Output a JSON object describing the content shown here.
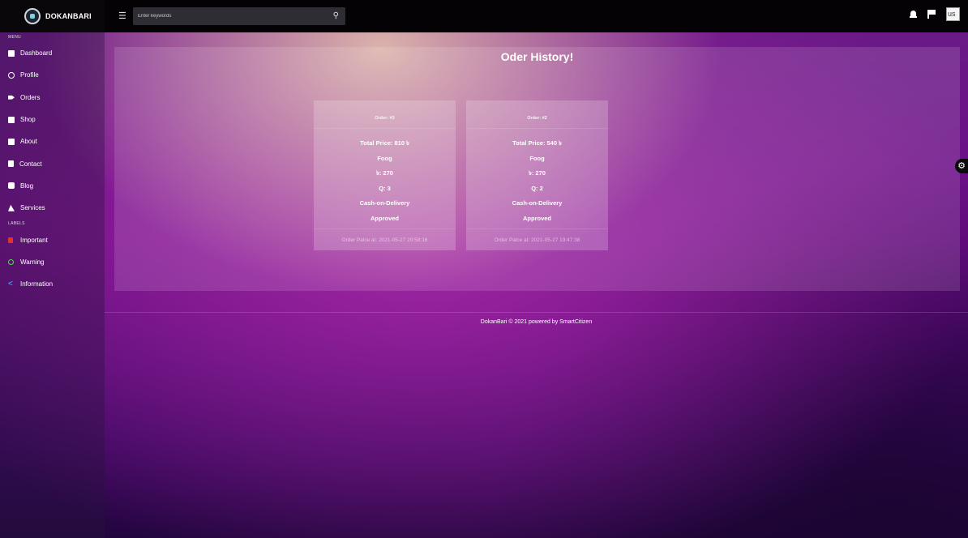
{
  "brand": {
    "name": "DOKANBARI"
  },
  "search": {
    "placeholder": "Enter keywords"
  },
  "header": {
    "avatar_text": "us"
  },
  "sidebar": {
    "menu_heading": "MENU",
    "items": [
      {
        "label": "Dashboard",
        "icon": "dashboard-icon"
      },
      {
        "label": "Profile",
        "icon": "profile-icon"
      },
      {
        "label": "Orders",
        "icon": "tag-icon"
      },
      {
        "label": "Shop",
        "icon": "shop-icon"
      },
      {
        "label": "About",
        "icon": "id-card-icon"
      },
      {
        "label": "Contact",
        "icon": "contact-icon"
      },
      {
        "label": "Blog",
        "icon": "blog-icon"
      },
      {
        "label": "Services",
        "icon": "services-icon"
      }
    ],
    "labels_heading": "LABELS",
    "labels": [
      {
        "label": "Important",
        "color": "#e6332a"
      },
      {
        "label": "Warning",
        "color": "#5bd35b"
      },
      {
        "label": "Information",
        "color": "#4fb8ff"
      }
    ]
  },
  "main": {
    "title": "Oder History!",
    "orders": [
      {
        "order": "Order: #3",
        "total": "Total Price: 810 ৳",
        "product": "Foog",
        "unit_price": "৳: 270",
        "quantity": "Q: 3",
        "payment": "Cash-on-Delivery",
        "status": "Approved",
        "placed": "Order Palce at: 2021-05-27 20:58:16"
      },
      {
        "order": "Order: #2",
        "total": "Total Price: 540 ৳",
        "product": "Foog",
        "unit_price": "৳: 270",
        "quantity": "Q: 2",
        "payment": "Cash-on-Delivery",
        "status": "Approved",
        "placed": "Order Palce at: 2021-05-27 19:47:38"
      }
    ]
  },
  "footer": {
    "text": "DokanBari © 2021 powered by SmartCitizen"
  }
}
